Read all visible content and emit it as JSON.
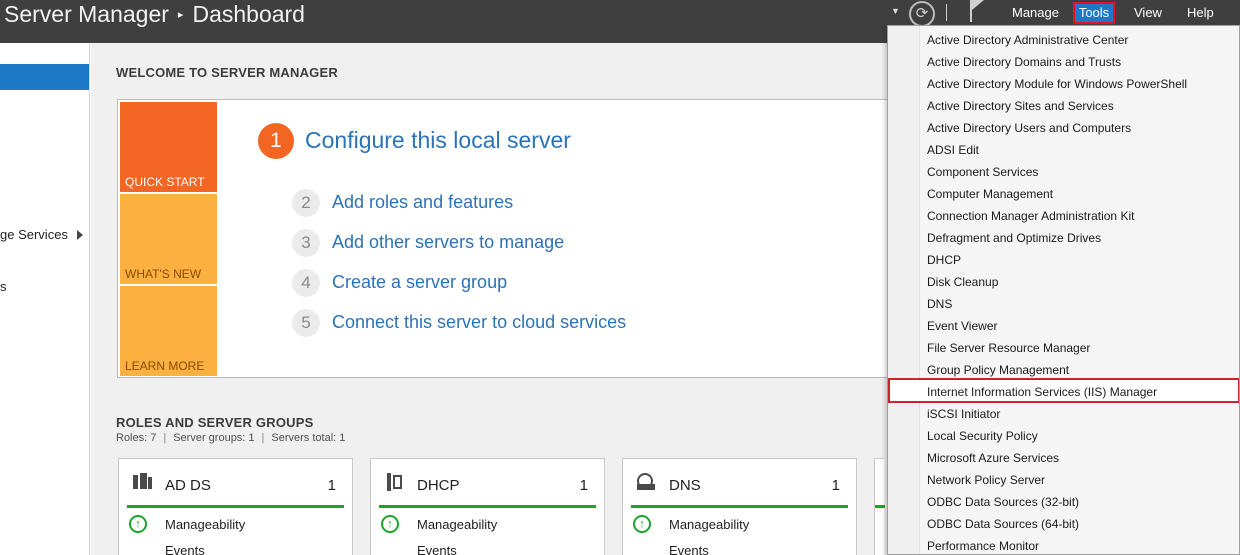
{
  "titlebar": {
    "app": "Server Manager",
    "separator": "▸",
    "page": "Dashboard",
    "menu": {
      "manage": "Manage",
      "tools": "Tools",
      "view": "View",
      "help": "Help"
    }
  },
  "leftnav": {
    "items": [
      {
        "label": "ge Services"
      },
      {
        "label": "s"
      }
    ]
  },
  "welcome": {
    "title": "WELCOME TO SERVER MANAGER",
    "tiles": {
      "quick_start": "QUICK START",
      "whats_new": "WHAT'S NEW",
      "learn_more": "LEARN MORE"
    },
    "primary_step": {
      "num": "1",
      "label": "Configure this local server"
    },
    "steps": [
      {
        "num": "2",
        "label": "Add roles and features"
      },
      {
        "num": "3",
        "label": "Add other servers to manage"
      },
      {
        "num": "4",
        "label": "Create a server group"
      },
      {
        "num": "5",
        "label": "Connect this server to cloud services"
      }
    ]
  },
  "roles": {
    "title": "ROLES AND SERVER GROUPS",
    "roles_count": "Roles: 7",
    "groups_count": "Server groups: 1",
    "servers_total": "Servers total: 1",
    "separator": "|",
    "cards": [
      {
        "name": "AD DS",
        "count": "1",
        "manageability": "Manageability",
        "events": "Events",
        "icon": "ad-ds-icon"
      },
      {
        "name": "DHCP",
        "count": "1",
        "manageability": "Manageability",
        "events": "Events",
        "icon": "dhcp-icon"
      },
      {
        "name": "DNS",
        "count": "1",
        "manageability": "Manageability",
        "events": "Events",
        "icon": "dns-icon"
      }
    ]
  },
  "tools_menu": {
    "items": [
      "Active Directory Administrative Center",
      "Active Directory Domains and Trusts",
      "Active Directory Module for Windows PowerShell",
      "Active Directory Sites and Services",
      "Active Directory Users and Computers",
      "ADSI Edit",
      "Component Services",
      "Computer Management",
      "Connection Manager Administration Kit",
      "Defragment and Optimize Drives",
      "DHCP",
      "Disk Cleanup",
      "DNS",
      "Event Viewer",
      "File Server Resource Manager",
      "Group Policy Management",
      "Internet Information Services (IIS) Manager",
      "iSCSI Initiator",
      "Local Security Policy",
      "Microsoft Azure Services",
      "Network Policy Server",
      "ODBC Data Sources (32-bit)",
      "ODBC Data Sources (64-bit)",
      "Performance Monitor"
    ],
    "highlighted_index": 16
  },
  "colors": {
    "titlebar_bg": "#3f3f3f",
    "accent_blue": "#1e78c8",
    "quick_start_orange": "#f26522",
    "tile_yellow": "#fbb040",
    "status_green": "#1ea32b",
    "highlight_red": "#d0202d"
  }
}
